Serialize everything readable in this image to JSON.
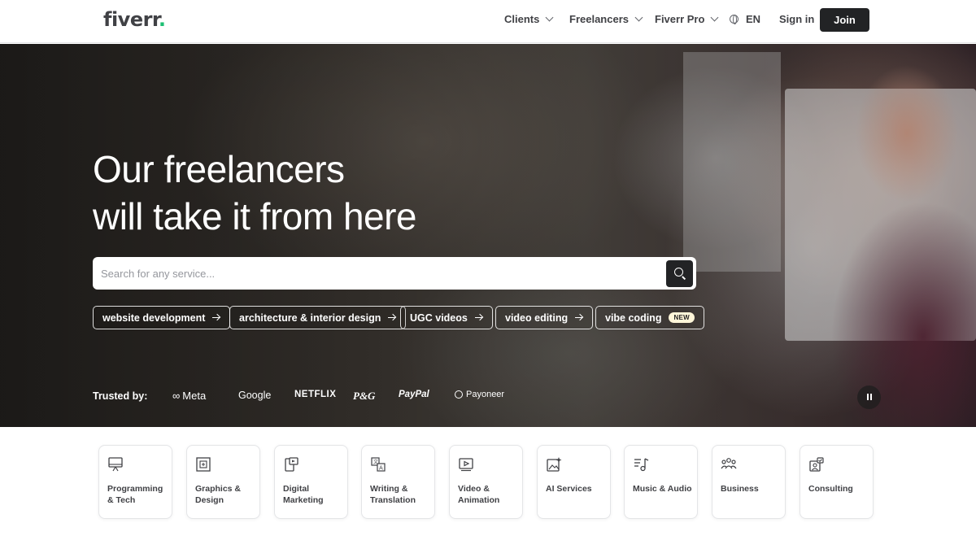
{
  "header": {
    "logo": "fiverr",
    "logo_dot": ".",
    "nav": [
      {
        "label": "Clients"
      },
      {
        "label": "Freelancers"
      },
      {
        "label": "Fiverr Pro"
      }
    ],
    "language": "EN",
    "sign_in": "Sign in",
    "join": "Join"
  },
  "hero": {
    "title_line1": "Our freelancers",
    "title_line2": "will take it from here",
    "search_placeholder": "Search for any service...",
    "chips": [
      {
        "label": "website development"
      },
      {
        "label": "architecture & interior design"
      },
      {
        "label": "UGC videos"
      },
      {
        "label": "video editing"
      },
      {
        "label": "vibe coding",
        "badge": "NEW"
      }
    ],
    "trusted_label": "Trusted by:",
    "brands": [
      "Meta",
      "Google",
      "NETFLIX",
      "P&G",
      "PayPal",
      "Payoneer"
    ]
  },
  "categories": [
    {
      "label": "Programming & Tech",
      "icon": "programming-icon"
    },
    {
      "label": "Graphics & Design",
      "icon": "graphics-icon"
    },
    {
      "label": "Digital Marketing",
      "icon": "marketing-icon"
    },
    {
      "label": "Writing & Translation",
      "icon": "writing-icon"
    },
    {
      "label": "Video & Animation",
      "icon": "video-icon"
    },
    {
      "label": "AI Services",
      "icon": "ai-icon"
    },
    {
      "label": "Music & Audio",
      "icon": "music-icon"
    },
    {
      "label": "Business",
      "icon": "business-icon"
    },
    {
      "label": "Consulting",
      "icon": "consulting-icon"
    }
  ],
  "colors": {
    "brand_green": "#1dbf73",
    "dark": "#222325"
  }
}
